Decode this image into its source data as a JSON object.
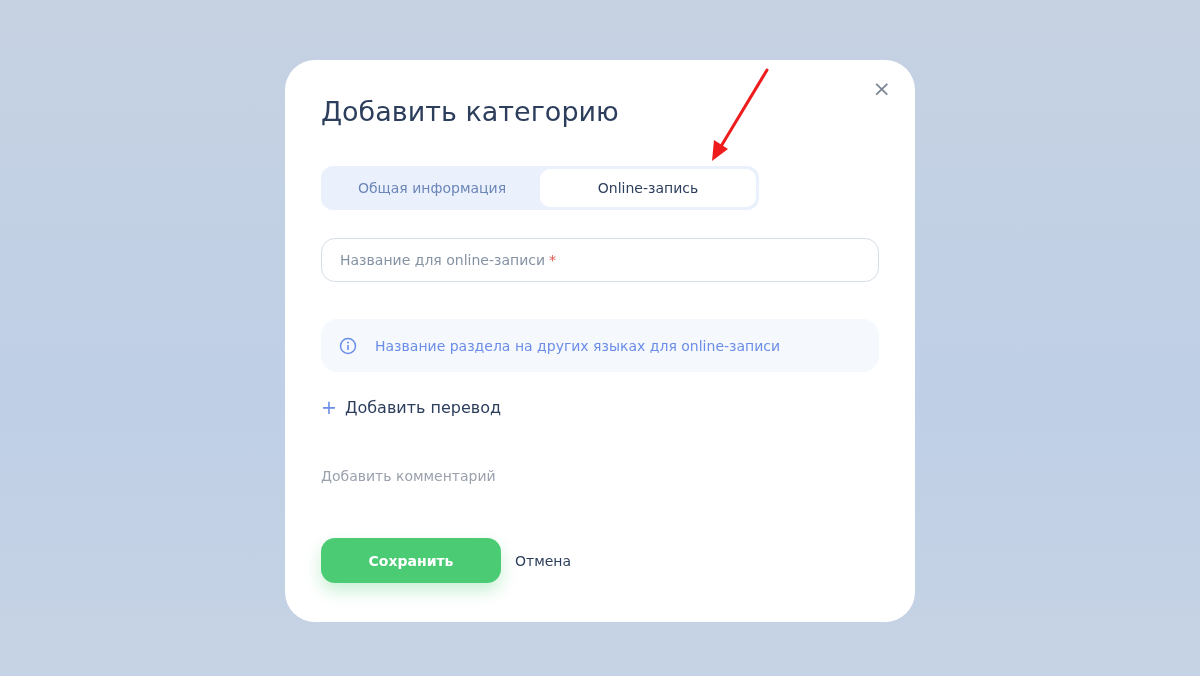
{
  "dialog": {
    "title": "Добавить категорию",
    "close": "×",
    "tabs": [
      {
        "label": "Общая информация",
        "selected": false
      },
      {
        "label": "Online-запись",
        "selected": true
      }
    ],
    "name_field": {
      "placeholder": "Название для online-записи",
      "required_mark": "*"
    },
    "info": {
      "text": "Название раздела на других языках для online-записи"
    },
    "add_translation": {
      "icon": "+",
      "label": "Добавить перевод"
    },
    "add_comment": "Добавить комментарий",
    "buttons": [
      {
        "kind": "primary",
        "label": "Сохранить"
      },
      {
        "kind": "link",
        "label": "Отмена"
      }
    ]
  },
  "annotation": {
    "kind": "arrow"
  }
}
